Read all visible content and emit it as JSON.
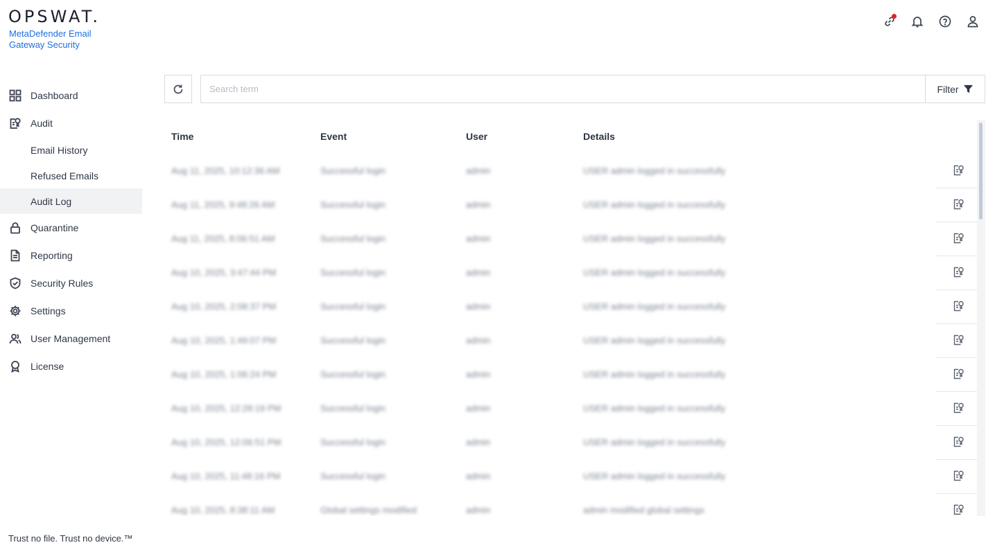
{
  "brand": {
    "logo": "OPSWAT.",
    "product": "MetaDefender Email Gateway Security",
    "tagline": "Trust no file. Trust no device.™"
  },
  "sidebar": {
    "items": [
      {
        "label": "Dashboard",
        "icon": "grid-icon"
      },
      {
        "label": "Audit",
        "icon": "audit-icon"
      },
      {
        "label": "Email History",
        "sub": true
      },
      {
        "label": "Refused Emails",
        "sub": true
      },
      {
        "label": "Audit Log",
        "sub": true,
        "active": true
      },
      {
        "label": "Quarantine",
        "icon": "lock-icon"
      },
      {
        "label": "Reporting",
        "icon": "document-icon"
      },
      {
        "label": "Security Rules",
        "icon": "shield-check-icon"
      },
      {
        "label": "Settings",
        "icon": "gear-icon"
      },
      {
        "label": "User Management",
        "icon": "users-icon"
      },
      {
        "label": "License",
        "icon": "award-icon"
      }
    ]
  },
  "header_icons": [
    "link-icon",
    "bell-icon",
    "help-icon",
    "user-icon"
  ],
  "notification_dot_color": "#e02424",
  "toolbar": {
    "search_placeholder": "Search term",
    "filter_label": "Filter"
  },
  "table": {
    "columns": [
      "Time",
      "Event",
      "User",
      "Details"
    ],
    "rows": [
      {
        "time": "Aug 11, 2025, 10:12:36 AM",
        "event": "Successful login",
        "user": "admin",
        "details": "USER admin logged in successfully"
      },
      {
        "time": "Aug 11, 2025, 9:48:26 AM",
        "event": "Successful login",
        "user": "admin",
        "details": "USER admin logged in successfully"
      },
      {
        "time": "Aug 11, 2025, 8:06:51 AM",
        "event": "Successful login",
        "user": "admin",
        "details": "USER admin logged in successfully"
      },
      {
        "time": "Aug 10, 2025, 3:47:44 PM",
        "event": "Successful login",
        "user": "admin",
        "details": "USER admin logged in successfully"
      },
      {
        "time": "Aug 10, 2025, 2:08:37 PM",
        "event": "Successful login",
        "user": "admin",
        "details": "USER admin logged in successfully"
      },
      {
        "time": "Aug 10, 2025, 1:49:07 PM",
        "event": "Successful login",
        "user": "admin",
        "details": "USER admin logged in successfully"
      },
      {
        "time": "Aug 10, 2025, 1:06:24 PM",
        "event": "Successful login",
        "user": "admin",
        "details": "USER admin logged in successfully"
      },
      {
        "time": "Aug 10, 2025, 12:28:19 PM",
        "event": "Successful login",
        "user": "admin",
        "details": "USER admin logged in successfully"
      },
      {
        "time": "Aug 10, 2025, 12:06:51 PM",
        "event": "Successful login",
        "user": "admin",
        "details": "USER admin logged in successfully"
      },
      {
        "time": "Aug 10, 2025, 11:48:16 PM",
        "event": "Successful login",
        "user": "admin",
        "details": "USER admin logged in successfully"
      },
      {
        "time": "Aug 10, 2025, 8:38:11 AM",
        "event": "Global settings modified",
        "user": "admin",
        "details": "admin modified global settings"
      }
    ]
  }
}
